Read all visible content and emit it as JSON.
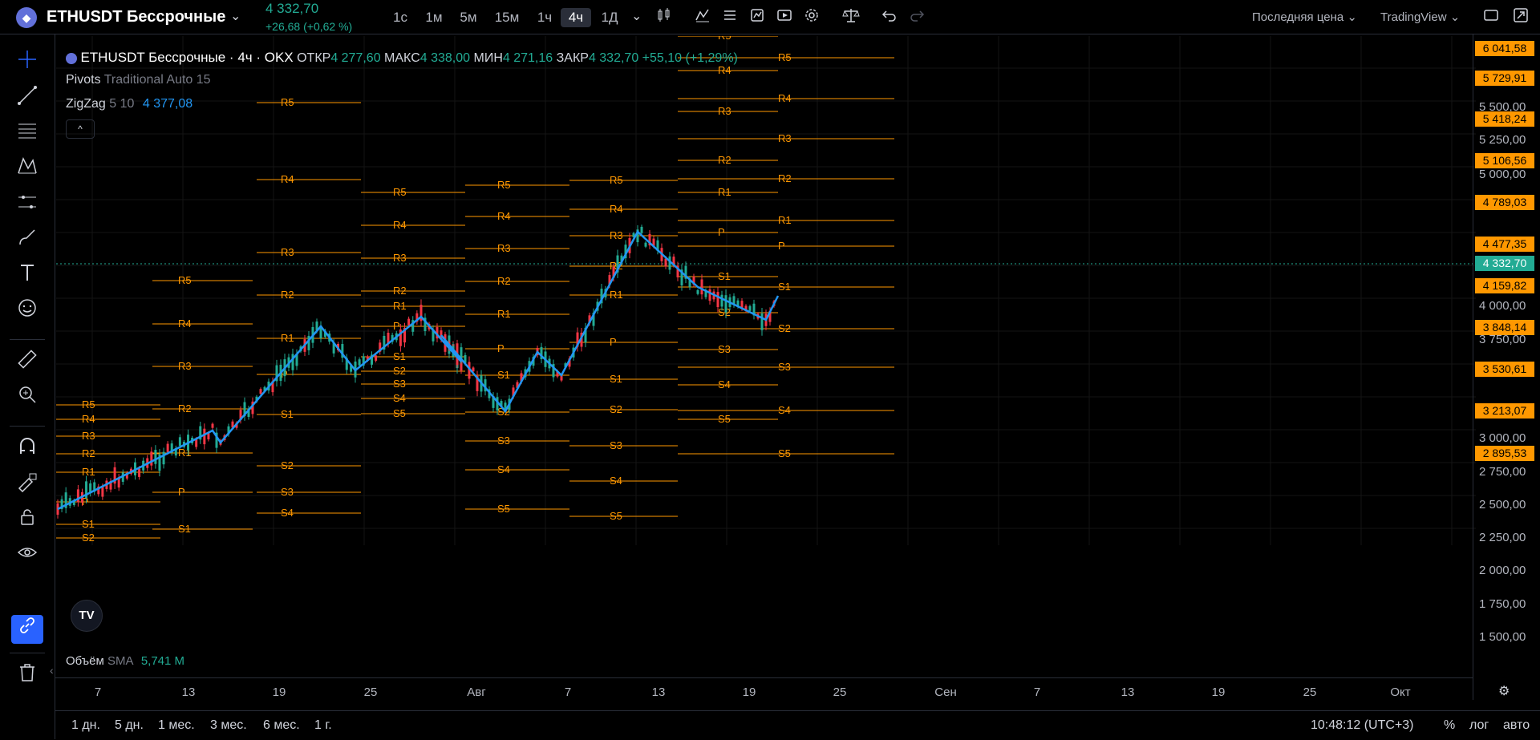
{
  "header": {
    "symbol_icon": "ethereum-icon",
    "symbol": "ETHUSDT Бессрочные",
    "last_price": "4 332,70",
    "change": "+26,68 (+0,62 %)",
    "timeframes": [
      "1с",
      "1м",
      "5м",
      "15м",
      "1ч",
      "4ч",
      "1Д"
    ],
    "active_timeframe": "4ч",
    "price_type": "Последняя цена",
    "layout_name": "TradingView"
  },
  "toolbar_icons": [
    "chart-type-icon",
    "indicators-icon",
    "templates-icon",
    "alert-icon",
    "replay-icon",
    "settings-icon",
    "compare-icon",
    "undo-icon",
    "redo-icon",
    "fullscreen-icon",
    "screenshot-icon"
  ],
  "left_tools": [
    "crosshair-icon",
    "trendline-icon",
    "fib-icon",
    "pattern-icon",
    "forecast-icon",
    "brush-icon",
    "text-icon",
    "emoji-icon",
    "ruler-icon",
    "zoom-icon",
    "magnet-icon",
    "lock-drawing-icon",
    "lock-icon",
    "eye-icon",
    "link-icon",
    "trash-icon"
  ],
  "legend": {
    "title": "ETHUSDT Бессрочные · 4ч · OKX",
    "open_label": "ОТКР",
    "open": "4 277,60",
    "high_label": "МАКС",
    "high": "4 338,00",
    "low_label": "МИН",
    "low": "4 271,16",
    "close_label": "ЗАКР",
    "close": "4 332,70",
    "close_change": "+55,10 (+1,29%)",
    "pivots_name": "Pivots",
    "pivots_params": "Traditional Auto 15",
    "zigzag_name": "ZigZag",
    "zigzag_params": "5 10",
    "zigzag_value": "4 377,08",
    "volume_name": "Объём",
    "volume_ma": "SMA",
    "volume_value": "5,741 M"
  },
  "colors": {
    "up": "#22ab94",
    "down": "#f23645",
    "pivot": "#ff9800",
    "zigzag": "#2196f3",
    "accent": "#2962ff"
  },
  "price_axis": [
    "5 500,00",
    "5 250,00",
    "5 000,00",
    "4 000,00",
    "3 750,00",
    "3 000,00",
    "2 750,00",
    "2 500,00",
    "2 250,00",
    "2 000,00",
    "1 750,00",
    "1 500,00"
  ],
  "price_badges": [
    {
      "value": "6 041,58"
    },
    {
      "value": "5 729,91"
    },
    {
      "value": "5 418,24"
    },
    {
      "value": "5 106,56"
    },
    {
      "value": "4 789,03"
    },
    {
      "value": "4 477,35"
    },
    {
      "value": "4 332,70",
      "current": true
    },
    {
      "value": "4 159,82"
    },
    {
      "value": "3 848,14"
    },
    {
      "value": "3 530,61"
    },
    {
      "value": "3 213,07"
    },
    {
      "value": "2 895,53"
    }
  ],
  "time_axis": [
    "7",
    "13",
    "19",
    "25",
    "Авг",
    "7",
    "13",
    "19",
    "25",
    "Сен",
    "7",
    "13",
    "19",
    "25",
    "Окт"
  ],
  "ranges": [
    "1 дн.",
    "5 дн.",
    "1 мес.",
    "3 мес.",
    "6 мес.",
    "1 г."
  ],
  "status": {
    "time": "10:48:12 (UTC+3)",
    "percent": "%",
    "log": "лог",
    "auto": "авто"
  },
  "pivot_labels": [
    "R5",
    "R4",
    "R3",
    "R2",
    "R1",
    "P",
    "S1",
    "S2",
    "S3",
    "S4",
    "S5"
  ]
}
